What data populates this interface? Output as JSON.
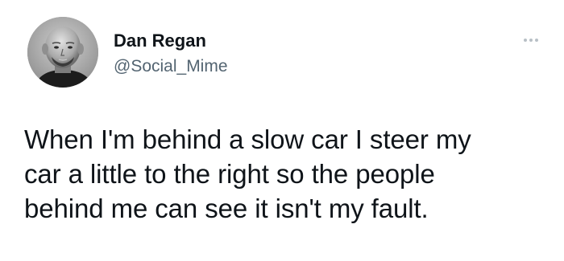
{
  "tweet": {
    "author": {
      "display_name": "Dan Regan",
      "handle": "@Social_Mime",
      "avatar_icon": "profile-photo-icon"
    },
    "more_icon": "more-options-icon",
    "text_lines": [
      "When I'm behind a slow car I steer my",
      "car a little to the right so the people",
      "behind me can see it isn't my fault."
    ]
  },
  "colors": {
    "background": "#ffffff",
    "text_primary": "#0f1419",
    "text_secondary": "#536471",
    "icon_muted": "#b8c0c6"
  }
}
